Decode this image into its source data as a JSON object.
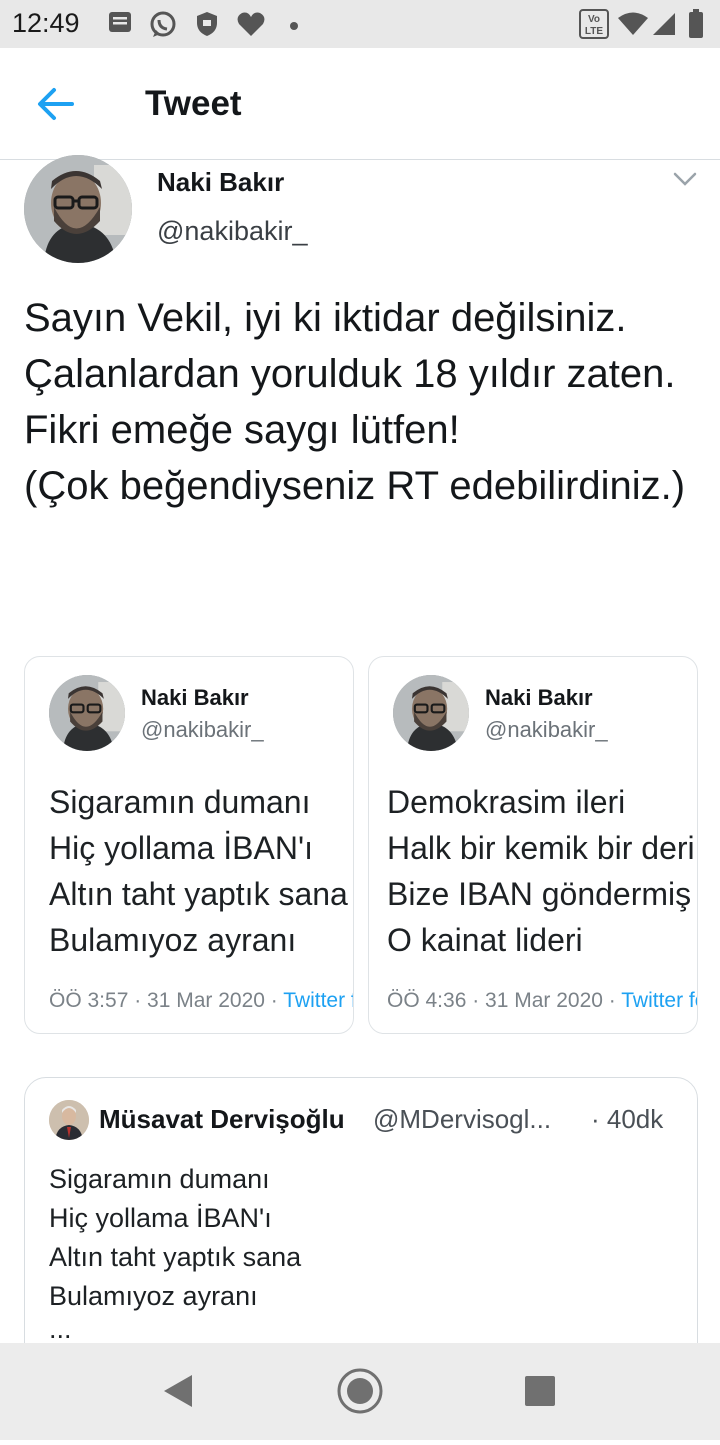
{
  "status_bar": {
    "time": "12:49",
    "left_icons": [
      "message-icon",
      "whatsapp-icon",
      "shield-icon",
      "heart-icon",
      "dot-icon"
    ],
    "right_icons": [
      "volte-icon",
      "wifi-icon",
      "signal-icon",
      "battery-icon"
    ],
    "volte_label": "Vo LTE"
  },
  "app_bar": {
    "title": "Tweet",
    "back_icon": "arrow-left-icon"
  },
  "tweet": {
    "author_name": "Naki Bakır",
    "author_handle": "@nakibakir_",
    "text": "Sayın Vekil, iyi ki iktidar değilsiniz.\nÇalanlardan yorulduk 18 yıldır zaten.\nFikri emeğe saygı lütfen!\n(Çok beğendiyseniz RT edebilirdiniz.)"
  },
  "embedded_tweets": [
    {
      "name": "Naki Bakır",
      "handle": "@nakibakir_",
      "lines": "Sigaramın dumanı\nHiç yollama İBAN'ı\nAltın taht yaptık sana\nBulamıyoz ayranı",
      "meta": "ÖÖ 3:57 · 31 Mar 2020 · ",
      "source": "Twitter for Android"
    },
    {
      "name": "Naki Bakır",
      "handle": "@nakibakir_",
      "lines": "Demokrasim ileri\nHalk bir kemik bir deri\nBize IBAN göndermiş\nO kainat lideri",
      "meta": "ÖÖ 4:36 · 31 Mar 2020 · ",
      "source": "Twitter for Android"
    }
  ],
  "quoted_tweet": {
    "name": "Müsavat Dervişoğlu",
    "handle": "@MDervisogl...",
    "time": "· 40dk",
    "lines": "Sigaramın dumanı\nHiç yollama İBAN'ı\nAltın taht yaptık sana\nBulamıyoz ayranı",
    "more": "..."
  },
  "nav_bar": {
    "buttons": [
      "back-triangle-icon",
      "home-circle-icon",
      "recents-square-icon"
    ]
  },
  "colors": {
    "accent": "#1da1f2",
    "text": "#14171a",
    "secondary": "#6b7278"
  }
}
